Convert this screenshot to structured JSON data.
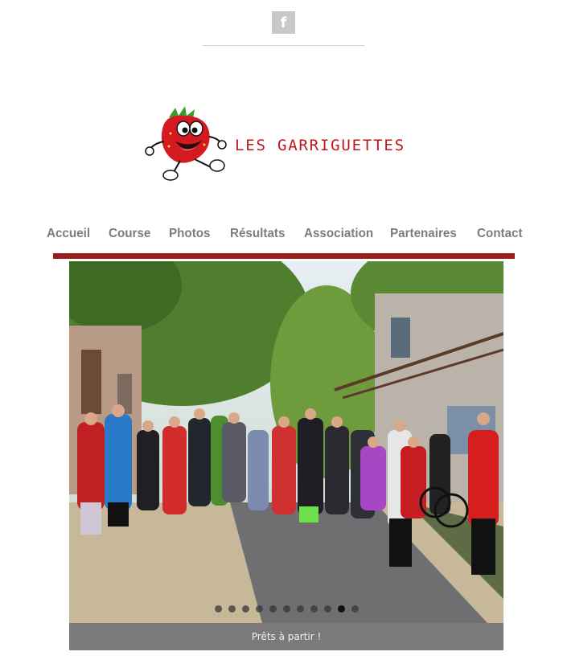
{
  "header": {
    "facebook_icon_glyph": "f",
    "logo_text": "LES GARRIGUETTES"
  },
  "nav": {
    "items": [
      {
        "label": "Accueil"
      },
      {
        "label": "Course"
      },
      {
        "label": "Photos"
      },
      {
        "label": "Résultats"
      },
      {
        "label": "Association"
      },
      {
        "label": "Partenaires"
      },
      {
        "label": "Contact"
      }
    ]
  },
  "slider": {
    "caption": "Prêts à partir !",
    "slide_count": 11,
    "active_index": 9
  },
  "colors": {
    "brand_red": "#c0161c",
    "nav_bar": "#9c1b1b",
    "nav_text": "#7d7d7d",
    "caption_bg": "#7a7a7a"
  }
}
